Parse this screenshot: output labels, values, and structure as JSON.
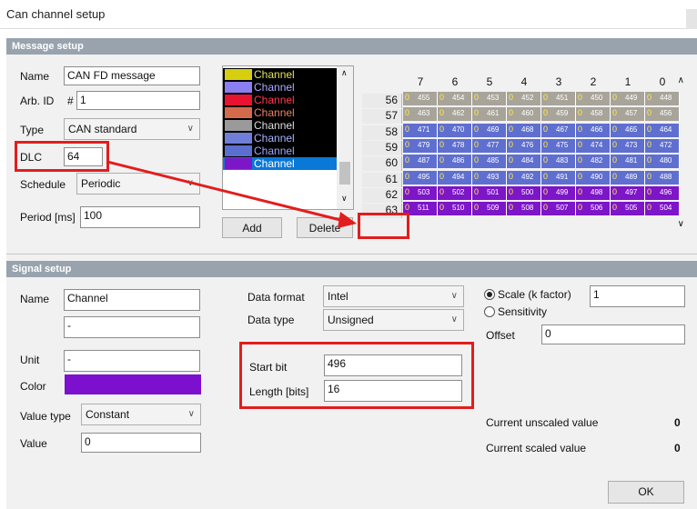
{
  "window": {
    "title": "Can channel setup"
  },
  "message_setup": {
    "header": "Message setup",
    "name_label": "Name",
    "name_value": "CAN FD message",
    "arb_id_label": "Arb. ID",
    "arb_id_prefix": "#",
    "arb_id_value": "1",
    "type_label": "Type",
    "type_value": "CAN standard",
    "dlc_label": "DLC",
    "dlc_value": "64",
    "schedule_label": "Schedule",
    "schedule_value": "Periodic",
    "period_label": "Period [ms]",
    "period_value": "100",
    "add_button": "Add",
    "delete_button": "Delete"
  },
  "channel_list": [
    {
      "label": "Channel",
      "color": "#d6cf10"
    },
    {
      "label": "Channel",
      "color": "#8a7ef0"
    },
    {
      "label": "Channel",
      "color": "#e8132f"
    },
    {
      "label": "Channel",
      "color": "#d46a4b"
    },
    {
      "label": "Channel",
      "color": "#9a9a9a"
    },
    {
      "label": "Channel",
      "color": "#6f7fd8"
    },
    {
      "label": "Channel",
      "color": "#5a6fd0"
    },
    {
      "label": "Channel",
      "color": "#7d15c8",
      "selected": true
    }
  ],
  "byte_grid": {
    "columns": [
      "7",
      "6",
      "5",
      "4",
      "3",
      "2",
      "1",
      "0"
    ],
    "rows": [
      {
        "row": "56",
        "color": "#a8a49a",
        "bits": [
          "455",
          "454",
          "453",
          "452",
          "451",
          "450",
          "449",
          "448"
        ]
      },
      {
        "row": "57",
        "color": "#a8a49a",
        "bits": [
          "463",
          "462",
          "461",
          "460",
          "459",
          "458",
          "457",
          "456"
        ]
      },
      {
        "row": "58",
        "color": "#5f6fd0",
        "bits": [
          "471",
          "470",
          "469",
          "468",
          "467",
          "466",
          "465",
          "464"
        ]
      },
      {
        "row": "59",
        "color": "#5f6fd0",
        "bits": [
          "479",
          "478",
          "477",
          "476",
          "475",
          "474",
          "473",
          "472"
        ]
      },
      {
        "row": "60",
        "color": "#5f6fd0",
        "bits": [
          "487",
          "486",
          "485",
          "484",
          "483",
          "482",
          "481",
          "480"
        ]
      },
      {
        "row": "61",
        "color": "#5f6fd0",
        "bits": [
          "495",
          "494",
          "493",
          "492",
          "491",
          "490",
          "489",
          "488"
        ]
      },
      {
        "row": "62",
        "color": "#7d15c8",
        "bits": [
          "503",
          "502",
          "501",
          "500",
          "499",
          "498",
          "497",
          "496"
        ]
      },
      {
        "row": "63",
        "color": "#7d15c8",
        "bits": [
          "511",
          "510",
          "509",
          "508",
          "507",
          "506",
          "505",
          "504"
        ]
      }
    ],
    "bit_value": "0"
  },
  "signal_setup": {
    "header": "Signal setup",
    "name_label": "Name",
    "name_value": "Channel",
    "description_value": "-",
    "unit_label": "Unit",
    "unit_value": "-",
    "color_label": "Color",
    "color_value": "#7d0fcf",
    "value_type_label": "Value type",
    "value_type_value": "Constant",
    "value_label": "Value",
    "value_value": "0",
    "data_format_label": "Data format",
    "data_format_value": "Intel",
    "data_type_label": "Data type",
    "data_type_value": "Unsigned",
    "start_bit_label": "Start bit",
    "start_bit_value": "496",
    "length_label": "Length [bits]",
    "length_value": "16",
    "scale_label": "Scale (k factor)",
    "scale_value": "1",
    "sensitivity_label": "Sensitivity",
    "offset_label": "Offset",
    "offset_value": "0",
    "unscaled_label": "Current unscaled value",
    "unscaled_value": "0",
    "scaled_label": "Current scaled value",
    "scaled_value": "0"
  },
  "ok_button": "OK"
}
